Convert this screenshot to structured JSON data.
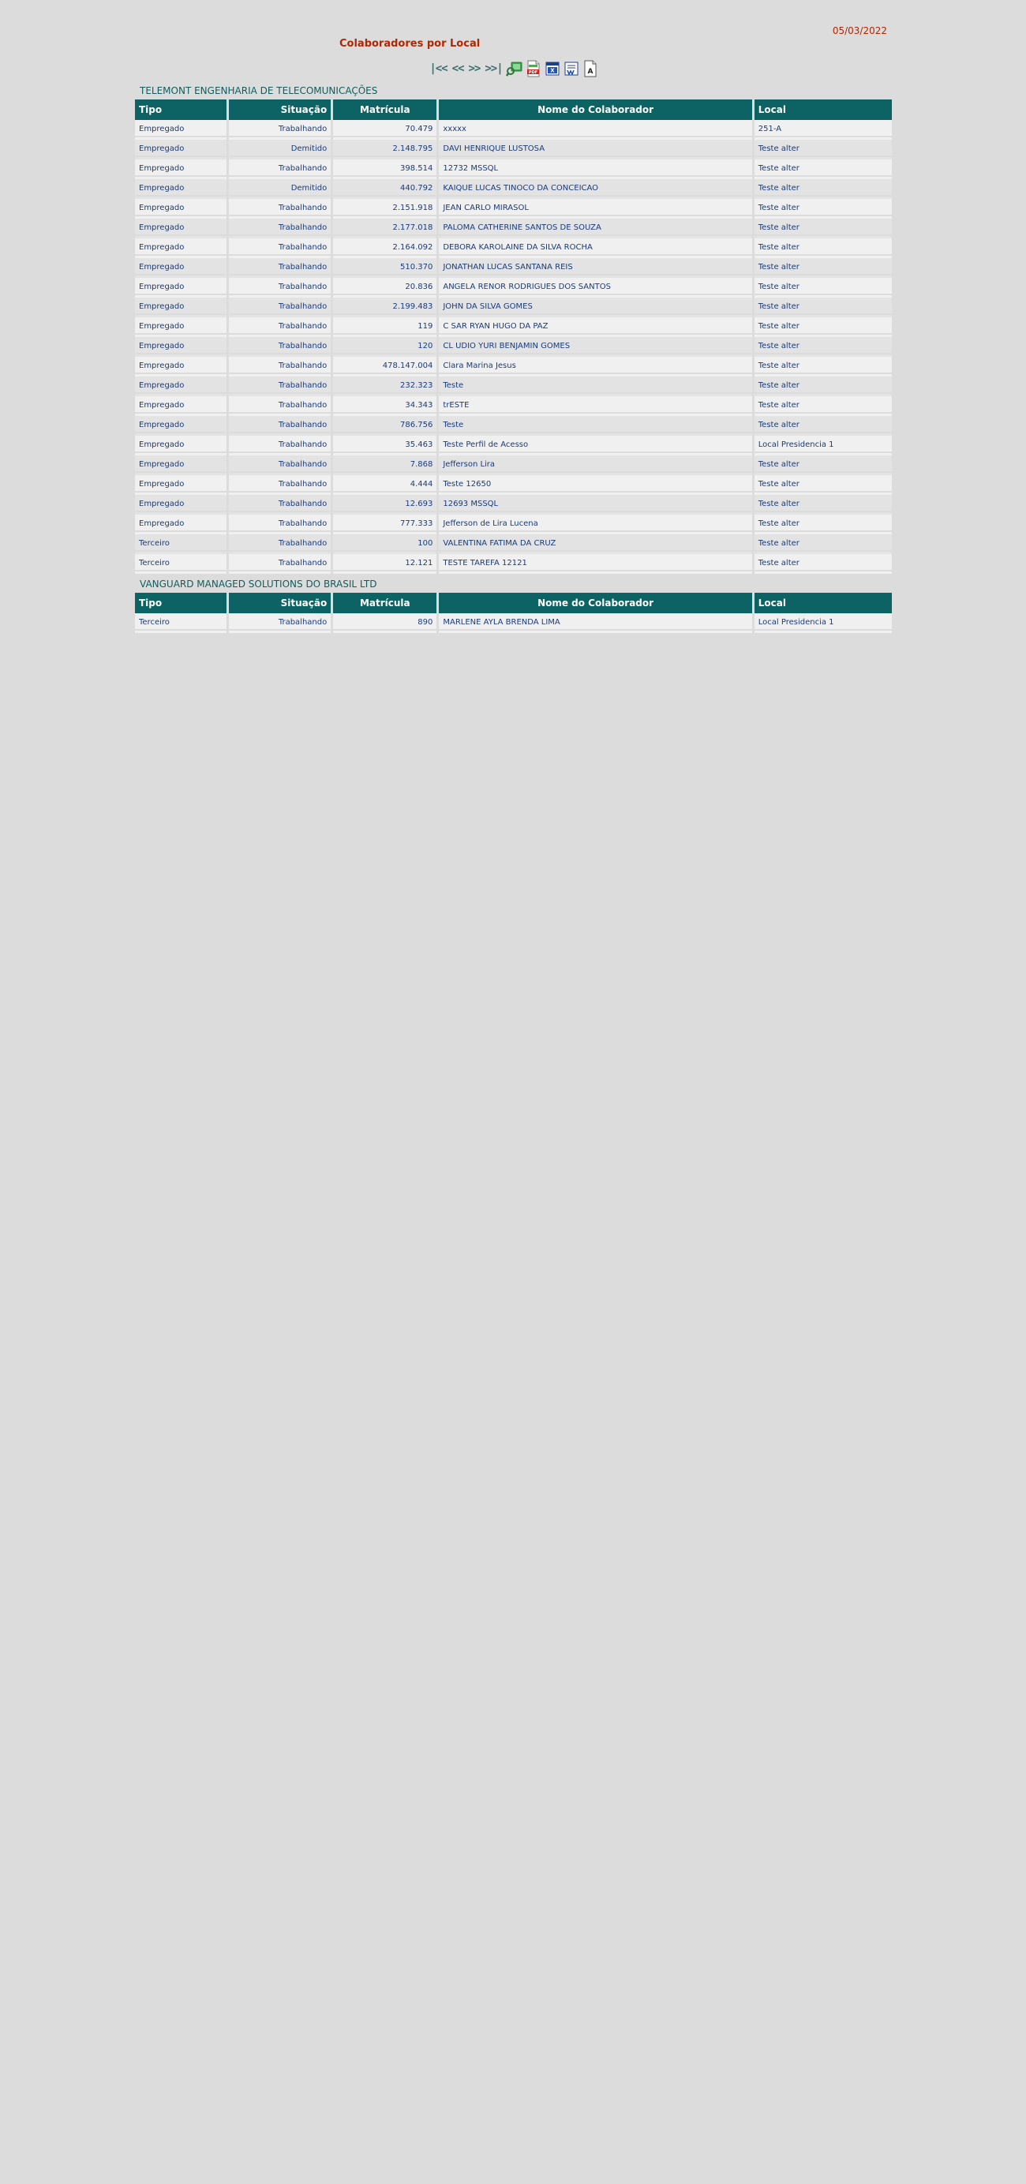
{
  "header": {
    "title": "Colaboradores por Local",
    "date": "05/03/2022"
  },
  "toolbar": {
    "first_label": "|<<",
    "prev_label": "<<",
    "next_label": ">>",
    "last_label": ">>|",
    "icons": [
      "search-icon",
      "pdf-icon",
      "excel-icon",
      "word-icon",
      "text-icon"
    ]
  },
  "columns": {
    "tipo": "Tipo",
    "situacao": "Situação",
    "matricula": "Matrícula",
    "nome": "Nome do Colaborador",
    "local": "Local"
  },
  "groups": [
    {
      "name": "TELEMONT ENGENHARIA DE TELECOMUNICAÇÕES",
      "rows": [
        {
          "tipo": "Empregado",
          "situacao": "Trabalhando",
          "matricula": "70.479",
          "nome": "xxxxx",
          "local": "251-A"
        },
        {
          "tipo": "Empregado",
          "situacao": "Demitido",
          "matricula": "2.148.795",
          "nome": "DAVI HENRIQUE LUSTOSA",
          "local": "Teste alter"
        },
        {
          "tipo": "Empregado",
          "situacao": "Trabalhando",
          "matricula": "398.514",
          "nome": "12732 MSSQL",
          "local": "Teste alter"
        },
        {
          "tipo": "Empregado",
          "situacao": "Demitido",
          "matricula": "440.792",
          "nome": "KAIQUE LUCAS TINOCO DA CONCEICAO",
          "local": "Teste alter"
        },
        {
          "tipo": "Empregado",
          "situacao": "Trabalhando",
          "matricula": "2.151.918",
          "nome": "JEAN CARLO MIRASOL",
          "local": "Teste alter"
        },
        {
          "tipo": "Empregado",
          "situacao": "Trabalhando",
          "matricula": "2.177.018",
          "nome": "PALOMA CATHERINE SANTOS DE SOUZA",
          "local": "Teste alter"
        },
        {
          "tipo": "Empregado",
          "situacao": "Trabalhando",
          "matricula": "2.164.092",
          "nome": "DEBORA KAROLAINE DA SILVA ROCHA",
          "local": "Teste alter"
        },
        {
          "tipo": "Empregado",
          "situacao": "Trabalhando",
          "matricula": "510.370",
          "nome": "JONATHAN LUCAS SANTANA REIS",
          "local": "Teste alter"
        },
        {
          "tipo": "Empregado",
          "situacao": "Trabalhando",
          "matricula": "20.836",
          "nome": "ANGELA RENOR RODRIGUES DOS SANTOS",
          "local": "Teste alter"
        },
        {
          "tipo": "Empregado",
          "situacao": "Trabalhando",
          "matricula": "2.199.483",
          "nome": "JOHN DA SILVA GOMES",
          "local": "Teste alter"
        },
        {
          "tipo": "Empregado",
          "situacao": "Trabalhando",
          "matricula": "119",
          "nome": "C SAR RYAN HUGO DA PAZ",
          "local": "Teste alter"
        },
        {
          "tipo": "Empregado",
          "situacao": "Trabalhando",
          "matricula": "120",
          "nome": "CL UDIO YURI BENJAMIN GOMES",
          "local": "Teste alter"
        },
        {
          "tipo": "Empregado",
          "situacao": "Trabalhando",
          "matricula": "478.147.004",
          "nome": "Clara Marina Jesus",
          "local": "Teste alter"
        },
        {
          "tipo": "Empregado",
          "situacao": "Trabalhando",
          "matricula": "232.323",
          "nome": "Teste",
          "local": "Teste alter"
        },
        {
          "tipo": "Empregado",
          "situacao": "Trabalhando",
          "matricula": "34.343",
          "nome": "trESTE",
          "local": "Teste alter"
        },
        {
          "tipo": "Empregado",
          "situacao": "Trabalhando",
          "matricula": "786.756",
          "nome": "Teste",
          "local": "Teste alter"
        },
        {
          "tipo": "Empregado",
          "situacao": "Trabalhando",
          "matricula": "35.463",
          "nome": "Teste Perfil de Acesso",
          "local": "Local Presidencia 1"
        },
        {
          "tipo": "Empregado",
          "situacao": "Trabalhando",
          "matricula": "7.868",
          "nome": "Jefferson Lira",
          "local": "Teste alter"
        },
        {
          "tipo": "Empregado",
          "situacao": "Trabalhando",
          "matricula": "4.444",
          "nome": "Teste 12650",
          "local": "Teste alter"
        },
        {
          "tipo": "Empregado",
          "situacao": "Trabalhando",
          "matricula": "12.693",
          "nome": "12693 MSSQL",
          "local": "Teste alter"
        },
        {
          "tipo": "Empregado",
          "situacao": "Trabalhando",
          "matricula": "777.333",
          "nome": "Jefferson de Lira Lucena",
          "local": "Teste alter"
        },
        {
          "tipo": "Terceiro",
          "situacao": "Trabalhando",
          "matricula": "100",
          "nome": "VALENTINA FATIMA DA CRUZ",
          "local": "Teste alter"
        },
        {
          "tipo": "Terceiro",
          "situacao": "Trabalhando",
          "matricula": "12.121",
          "nome": "TESTE TAREFA 12121",
          "local": "Teste alter"
        }
      ]
    },
    {
      "name": "VANGUARD MANAGED SOLUTIONS DO BRASIL LTD",
      "rows": [
        {
          "tipo": "Terceiro",
          "situacao": "Trabalhando",
          "matricula": "890",
          "nome": "MARLENE AYLA BRENDA LIMA",
          "local": "Local Presidencia 1"
        }
      ]
    }
  ],
  "colors": {
    "title": "#b22600",
    "header_bg": "#0d6363",
    "group_title": "#0f5e5e",
    "cell_text": "#1a3b7a",
    "page_bg": "#dcdcdc"
  }
}
